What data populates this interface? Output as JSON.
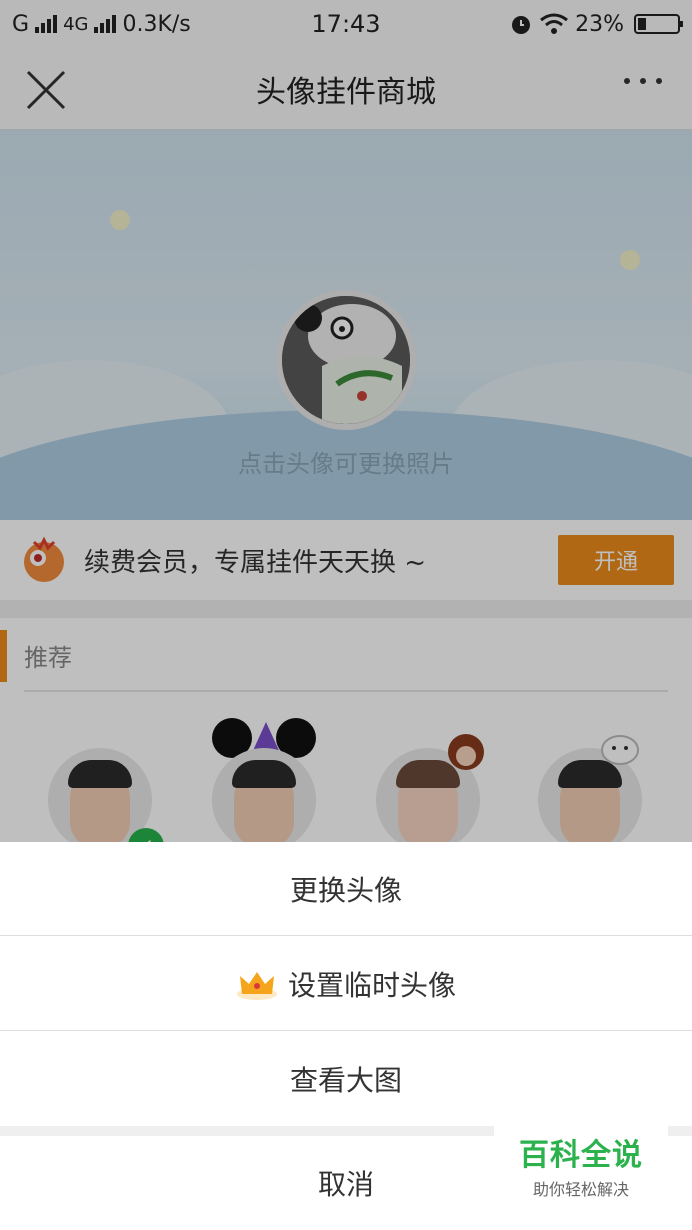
{
  "status_bar": {
    "left": "G",
    "network": "4G",
    "speed": "0.3K/s",
    "time": "17:43",
    "battery": "23%"
  },
  "nav": {
    "title": "头像挂件商城"
  },
  "hero": {
    "hint": "点击头像可更换照片"
  },
  "member": {
    "text": "续费会员，专属挂件天天换 ~",
    "button": "开通"
  },
  "recommend": {
    "title": "推荐"
  },
  "sheet": {
    "change_avatar": "更换头像",
    "temp_avatar": "设置临时头像",
    "view_large": "查看大图",
    "cancel": "取消"
  },
  "watermark": {
    "logo": "百科全说",
    "sub": "助你轻松解决"
  },
  "colors": {
    "accent_orange": "#ec8b1c",
    "check_green": "#26b24a",
    "watermark_green": "#2bb24c"
  }
}
